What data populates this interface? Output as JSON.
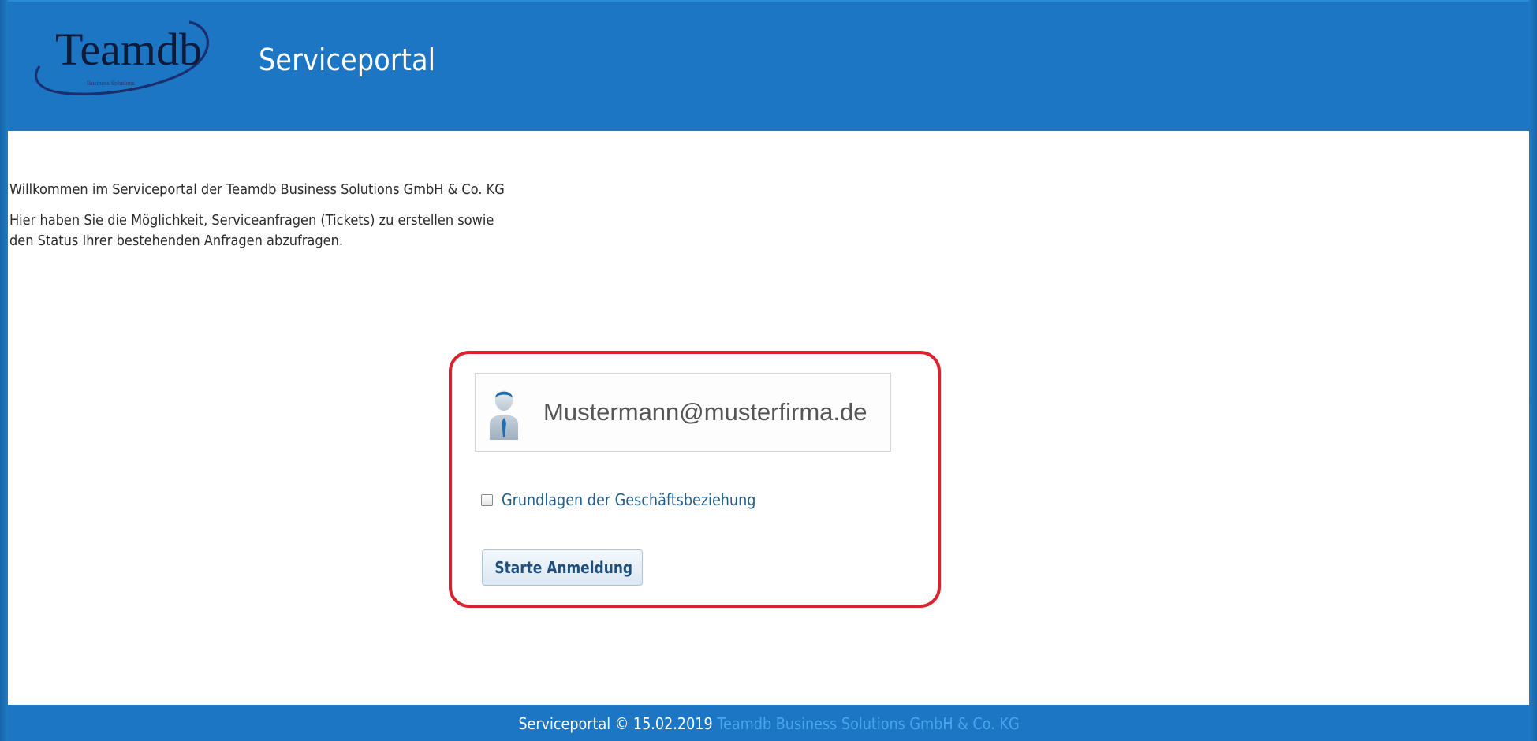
{
  "colors": {
    "header_bg": "#1c76c4",
    "highlight_border": "#d9232e",
    "link_text": "#1f5f8b",
    "footer_company": "#49a6ee"
  },
  "header": {
    "logo_text": "Teamdb",
    "logo_subtext": "Business Solutions",
    "title": "Serviceportal"
  },
  "intro": {
    "welcome": "Willkommen im Serviceportal der Teamdb Business Solutions GmbH & Co. KG",
    "line1": "Hier haben Sie die Möglichkeit, Serviceanfragen (Tickets) zu erstellen sowie",
    "line2": "den Status Ihrer bestehenden Anfragen abzufragen."
  },
  "login": {
    "user_icon": "user-avatar-icon",
    "email_value": "Mustermann@musterfirma.de",
    "checkbox_label": "Grundlagen der Geschäftsbeziehung",
    "checkbox_checked": false,
    "submit_label": "Starte Anmeldung"
  },
  "footer": {
    "text": "Serviceportal © 15.02.2019",
    "company": "Teamdb Business Solutions GmbH & Co. KG"
  }
}
